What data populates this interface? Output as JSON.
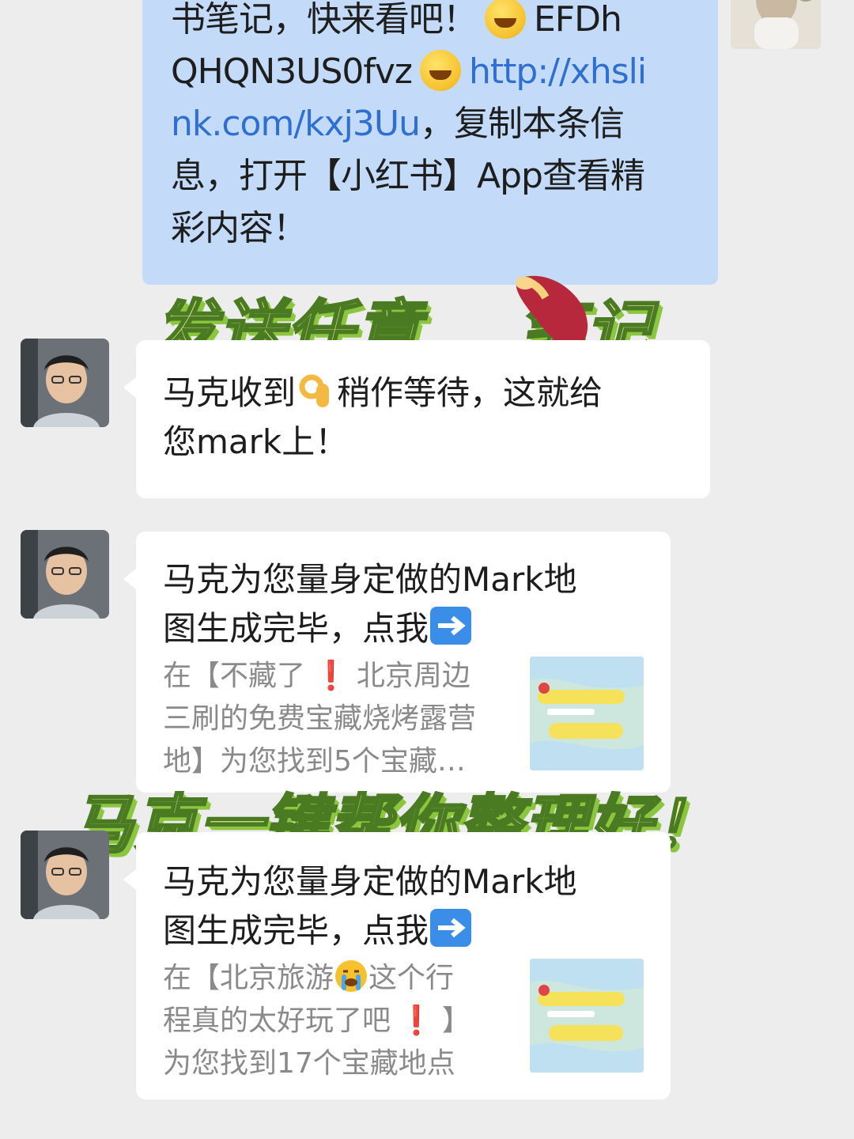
{
  "user_message": {
    "line1": "书笔记，快来看吧！",
    "code1": "EFDh",
    "code2": "QHQN3US0fvz",
    "link1": "http://xhsli",
    "link2": "nk.com/kxj3Uu",
    "after_link": "，复制本条信",
    "line4": "息，打开【小红书】App查看精",
    "line5": "彩内容！"
  },
  "overlay_top": {
    "part1": "发送任意",
    "part2": "笔记"
  },
  "reply_1": {
    "line1a": "马克收到",
    "line1b": "稍作等待，这就给",
    "line2": "您mark上！"
  },
  "card_1": {
    "title_line1": "马克为您量身定做的Mark地",
    "title_line2": "图生成完毕，点我",
    "desc_line1a": "在【不藏了",
    "desc_line1b": "北京周边",
    "desc_line2": "三刷的免费宝藏烧烤露营",
    "desc_line3": "地】为您找到5个宝藏…"
  },
  "overlay_bottom": {
    "text": "马克一键帮你整理好！"
  },
  "card_2": {
    "title_line1": "马克为您量身定做的Mark地",
    "title_line2": "图生成完毕，点我",
    "desc_line1a": "在【北京旅游",
    "desc_line1b": "这个行",
    "desc_line2a": "程真的太好玩了吧",
    "desc_line2b": "】",
    "desc_line3": "为您找到17个宝藏地点"
  },
  "colors": {
    "background": "#ededed",
    "user_bubble": "#c3dbf8",
    "link": "#2f6fd1",
    "overlay_fill": "#f4f1a6",
    "overlay_stroke": "#4a7a22"
  },
  "icons": [
    "grinning-squint-emoji",
    "ok-hand-emoji",
    "right-arrow-emoji",
    "exclamation-emoji",
    "crying-emoji",
    "sweet-potato-emoji",
    "map-thumbnail"
  ]
}
